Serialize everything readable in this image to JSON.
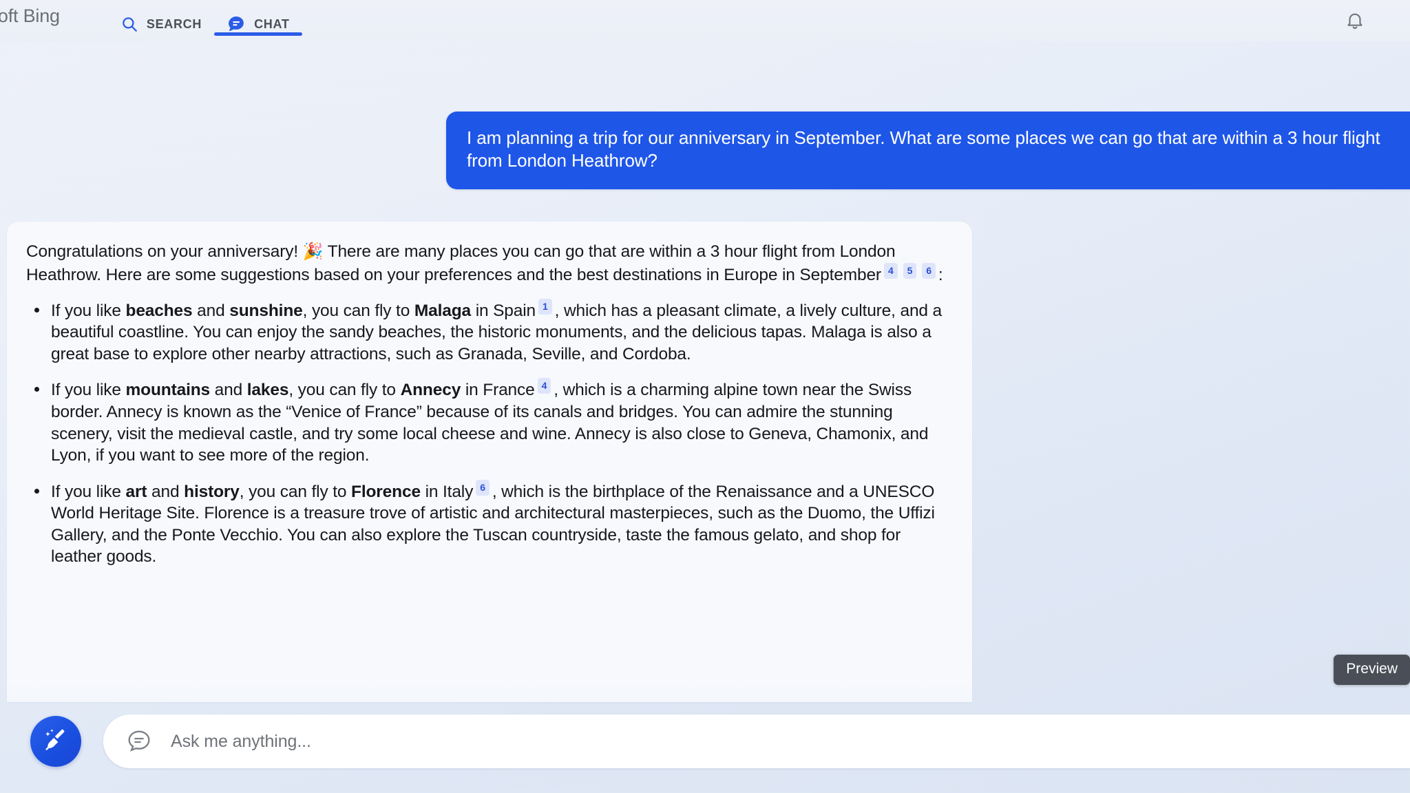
{
  "header": {
    "brand": "rosoft Bing",
    "tabs": [
      {
        "id": "search",
        "label": "SEARCH",
        "icon": "search-icon",
        "active": false
      },
      {
        "id": "chat",
        "label": "CHAT",
        "icon": "chat-bubble-icon",
        "active": true
      }
    ],
    "notification_icon": "bell-icon"
  },
  "conversation": {
    "user_message": "I am planning a trip for our anniversary in September. What are some places we can go that are within a 3 hour flight from London Heathrow?",
    "assistant": {
      "intro": {
        "part1": "Congratulations on your anniversary!",
        "emoji": "🎉",
        "part2": "There are many places you can go that are within a 3 hour flight from London Heathrow. Here are some suggestions based on your preferences and the best destinations in Europe in September",
        "citations": [
          "4",
          "5",
          "6"
        ],
        "trailing": ":"
      },
      "bullets": [
        {
          "lead": "If you like ",
          "bold1": "beaches",
          "mid1": " and ",
          "bold2": "sunshine",
          "mid2": ", you can fly to ",
          "bold3": "Malaga",
          "mid3": " in Spain",
          "citation": "1",
          "rest": ", which has a pleasant climate, a lively culture, and a beautiful coastline. You can enjoy the sandy beaches, the historic monuments, and the delicious tapas. Malaga is also a great base to explore other nearby attractions, such as Granada, Seville, and Cordoba."
        },
        {
          "lead": "If you like ",
          "bold1": "mountains",
          "mid1": " and ",
          "bold2": "lakes",
          "mid2": ", you can fly to ",
          "bold3": "Annecy",
          "mid3": " in France",
          "citation": "4",
          "rest": ", which is a charming alpine town near the Swiss border. Annecy is known as the “Venice of France” because of its canals and bridges. You can admire the stunning scenery, visit the medieval castle, and try some local cheese and wine. Annecy is also close to Geneva, Chamonix, and Lyon, if you want to see more of the region."
        },
        {
          "lead": "If you like ",
          "bold1": "art",
          "mid1": " and ",
          "bold2": "history",
          "mid2": ", you can fly to ",
          "bold3": "Florence",
          "mid3": " in Italy",
          "citation": "6",
          "rest": ", which is the birthplace of the Renaissance and a UNESCO World Heritage Site. Florence is a treasure trove of artistic and architectural masterpieces, such as the Duomo, the Uffizi Gallery, and the Ponte Vecchio. You can also explore the Tuscan countryside, taste the famous gelato, and shop for leather goods."
        }
      ]
    }
  },
  "tooltip": {
    "label": "Preview"
  },
  "composer": {
    "sweep_icon": "broom-icon",
    "input_icon": "chat-bubble-outline-icon",
    "placeholder": "Ask me anything..."
  },
  "colors": {
    "accent_blue": "#1e56e8",
    "tab_underline": "#2b5ce6",
    "citation_bg": "#dee5fb",
    "citation_text": "#2b4fd4",
    "response_bg": "#f7f9fd",
    "tooltip_bg": "#4a4f57"
  }
}
